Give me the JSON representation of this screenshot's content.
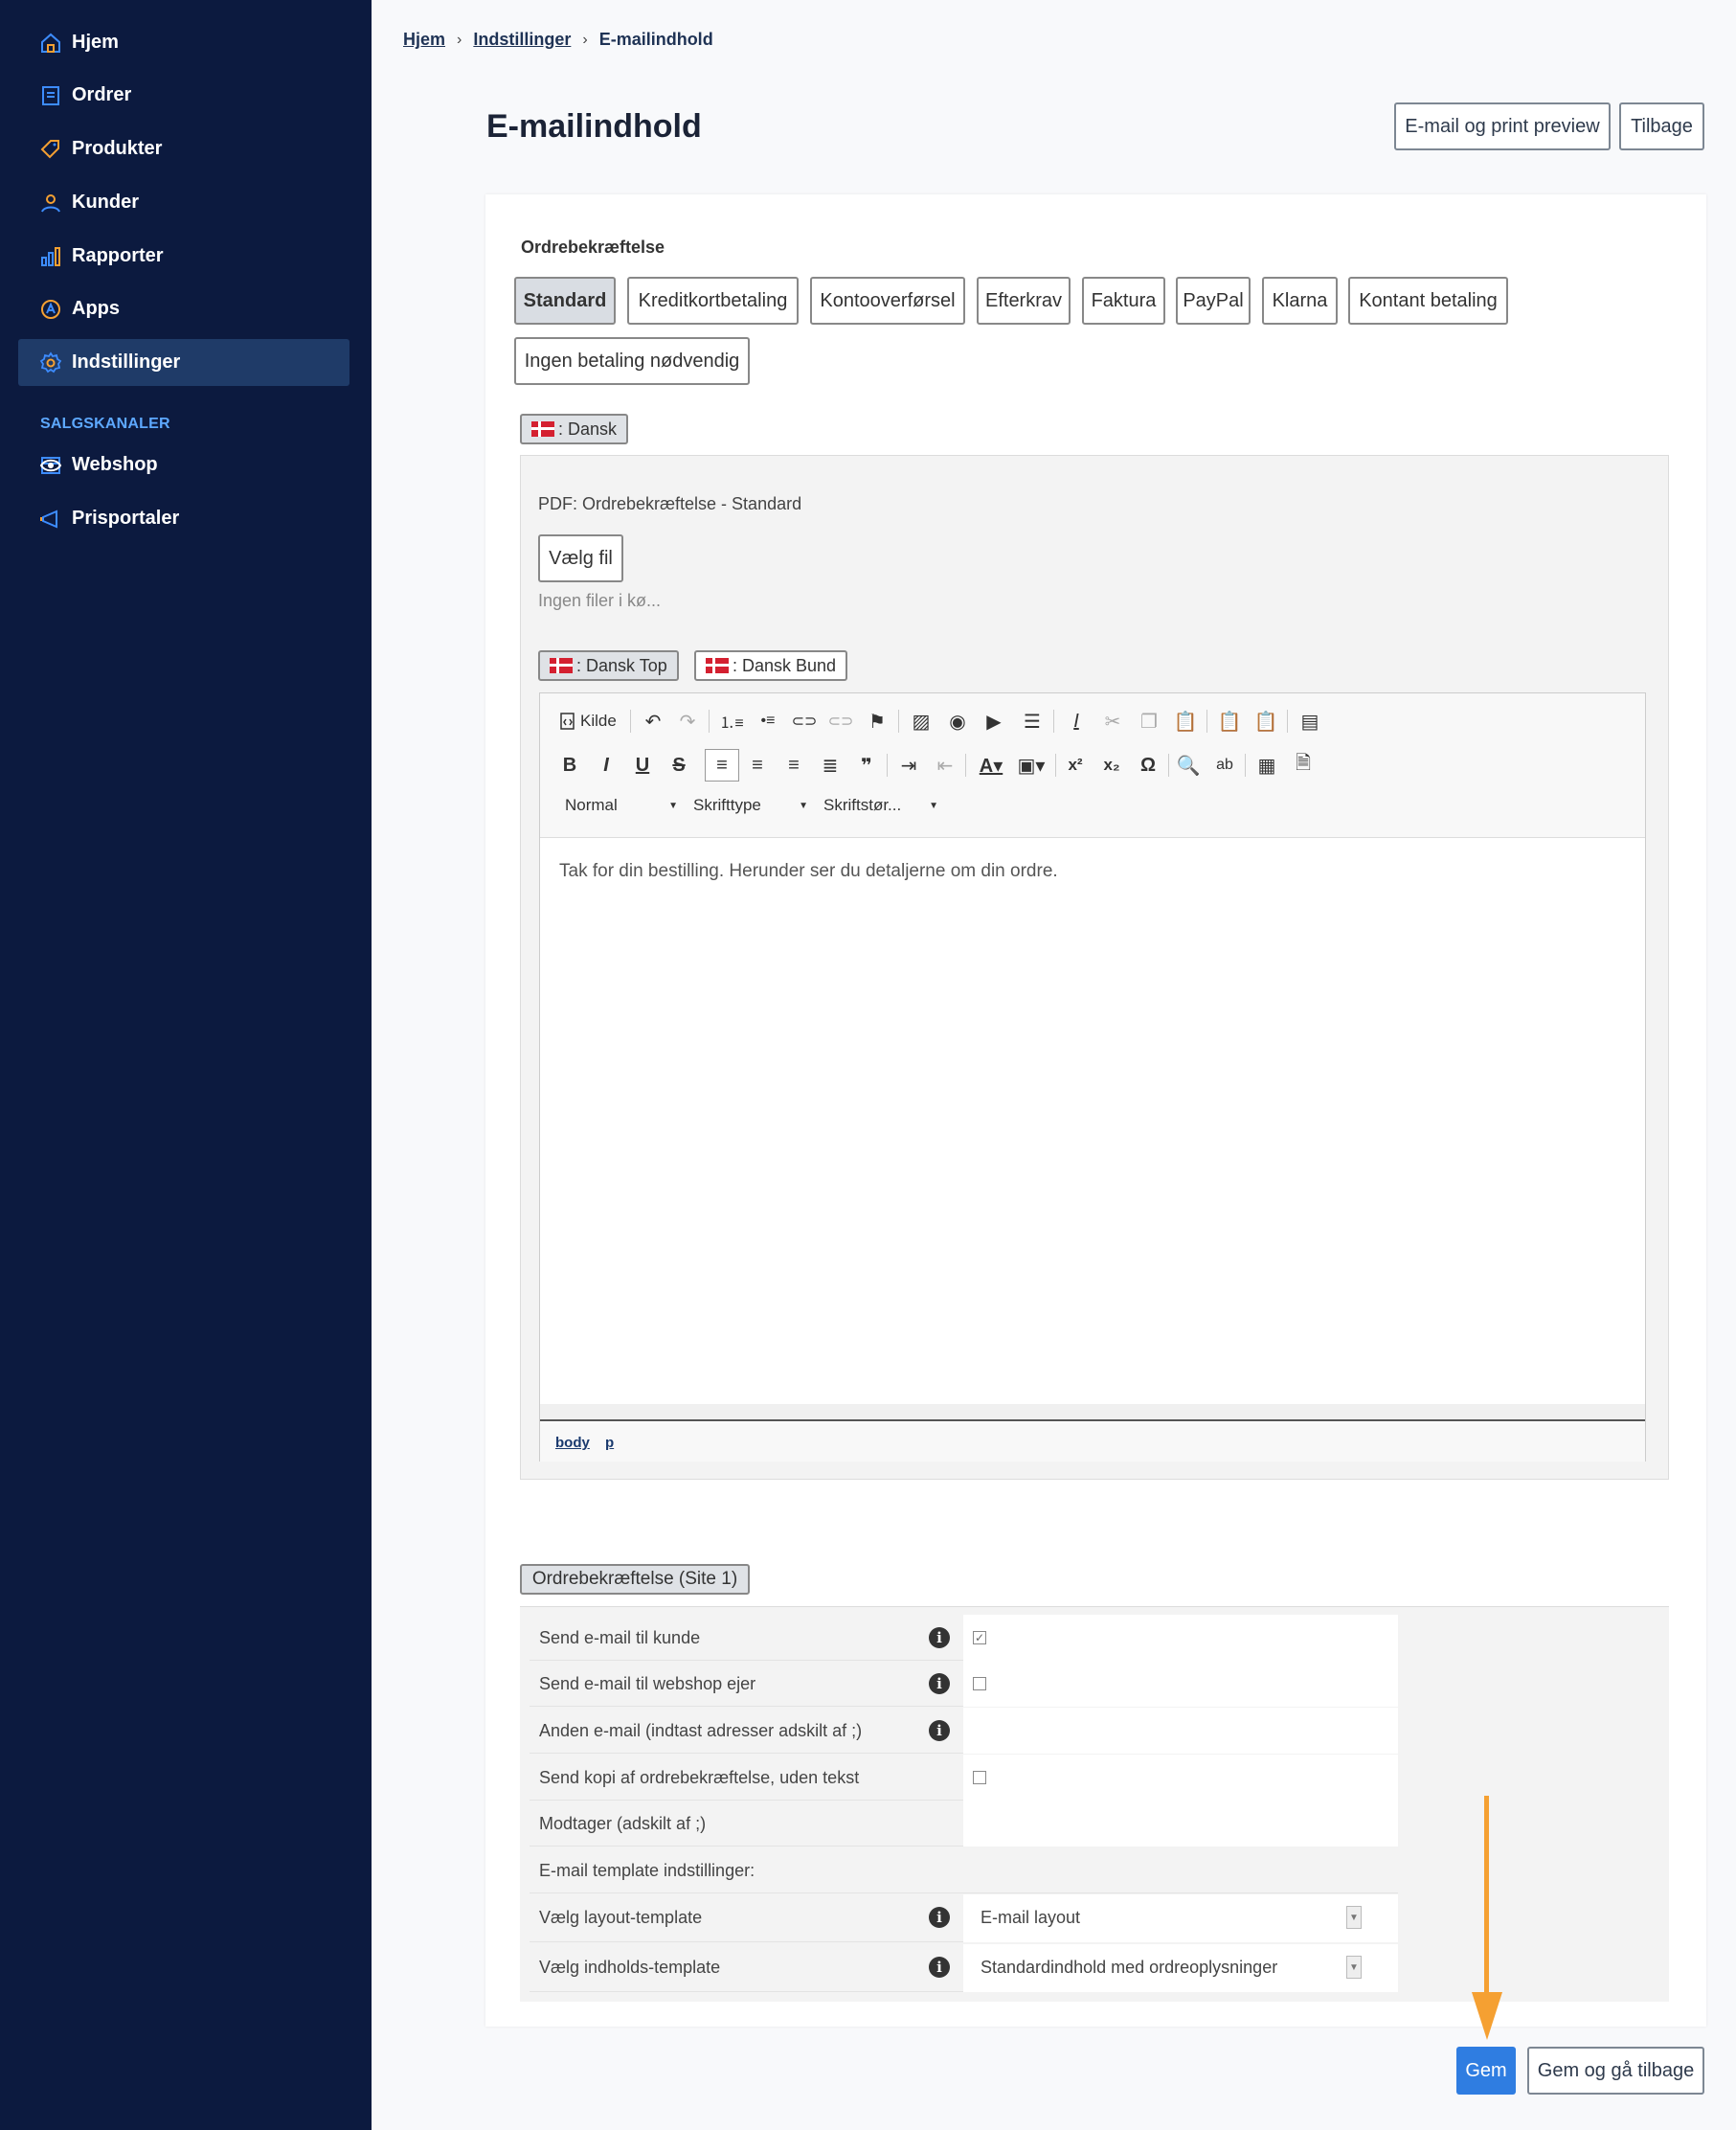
{
  "sidebar": {
    "items": [
      {
        "label": "Hjem",
        "icon": "home-icon"
      },
      {
        "label": "Ordrer",
        "icon": "orders-icon"
      },
      {
        "label": "Produkter",
        "icon": "tag-icon"
      },
      {
        "label": "Kunder",
        "icon": "user-icon"
      },
      {
        "label": "Rapporter",
        "icon": "chart-icon"
      },
      {
        "label": "Apps",
        "icon": "apps-icon"
      },
      {
        "label": "Indstillinger",
        "icon": "gear-icon"
      }
    ],
    "section_label": "SALGSKANALER",
    "channels": [
      {
        "label": "Webshop",
        "icon": "store-icon"
      },
      {
        "label": "Prisportaler",
        "icon": "megaphone-icon"
      }
    ],
    "active_color": "#1f3b68",
    "accent": "#5da8ff"
  },
  "breadcrumb": {
    "home": "Hjem",
    "settings": "Indstillinger",
    "current": "E-mailindhold"
  },
  "header": {
    "title": "E-mailindhold",
    "preview_button": "E-mail og print preview",
    "back_button": "Tilbage"
  },
  "group_title": "Ordrebekræftelse",
  "payment_tabs": [
    "Standard",
    "Kreditkortbetaling",
    "Kontooverførsel",
    "Efterkrav",
    "Faktura",
    "PayPal",
    "Klarna",
    "Kontant betaling",
    "Ingen betaling nødvendig"
  ],
  "language_tab": ": Dansk",
  "pdf": {
    "label": "PDF: Ordrebekræftelse - Standard",
    "choose_file": "Vælg fil",
    "no_files": "Ingen filer i kø..."
  },
  "editor_tabs": [
    ": Dansk Top",
    ": Dansk Bund"
  ],
  "editor": {
    "source_label": "Kilde",
    "format_combo": "Normal",
    "font_combo": "Skrifttype",
    "size_combo": "Skriftstør...",
    "content": "Tak for din bestilling. Herunder ser du detaljerne om din ordre.",
    "path": [
      "body",
      "p"
    ]
  },
  "section_badge": "Ordrebekræftelse (Site 1)",
  "form": {
    "send_customer": "Send e-mail til kunde",
    "send_owner": "Send e-mail til webshop ejer",
    "other_email": "Anden e-mail (indtast adresser adskilt af ;)",
    "send_copy": "Send kopi af ordrebekræftelse, uden tekst",
    "receiver": "Modtager (adskilt af ;)",
    "template_heading": "E-mail template indstillinger:",
    "layout_template": "Vælg layout-template",
    "layout_value": "E-mail layout",
    "content_template": "Vælg indholds-template",
    "content_value": "Standardindhold med ordreoplysninger",
    "send_customer_checked": true,
    "send_owner_checked": false,
    "send_copy_checked": false
  },
  "footer": {
    "save": "Gem",
    "save_back": "Gem og gå tilbage",
    "save_color": "#2f7de1",
    "arrow_color": "#f5a032"
  }
}
